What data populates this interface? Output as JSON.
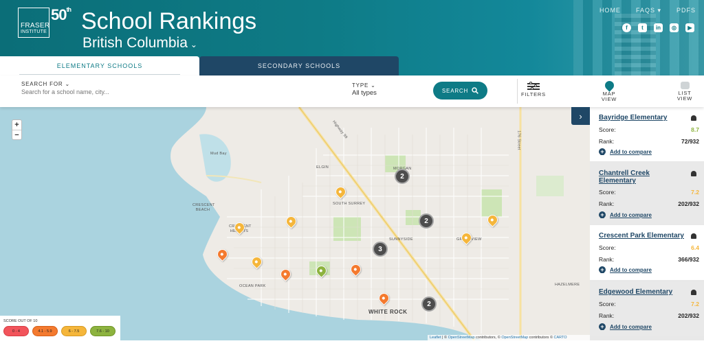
{
  "header": {
    "logo_line1": "FRASER",
    "logo_line2": "INSTITUTE",
    "anniversary": "50",
    "anniversary_sup": "th",
    "title": "School Rankings",
    "province": "British Columbia",
    "nav": [
      "HOME",
      "FAQS",
      "PDFS"
    ],
    "social": [
      "facebook",
      "twitter",
      "linkedin",
      "instagram",
      "youtube"
    ]
  },
  "tabs": {
    "elementary": "ELEMENTARY SCHOOLS",
    "secondary": "SECONDARY SCHOOLS"
  },
  "search": {
    "label": "SEARCH FOR",
    "placeholder": "Search for a school name, city...",
    "type_label": "TYPE",
    "type_value": "All types",
    "button": "SEARCH"
  },
  "tools": {
    "filters": "FILTERS",
    "map_view": "MAP VIEW",
    "list_view": "LIST VIEW"
  },
  "map": {
    "labels": [
      "Mud Bay",
      "ELGIN",
      "MORGAN",
      "SOUTH SURREY",
      "CRESCENT BEACH",
      "CRESCENT HEIGHTS",
      "SUNNYSIDE",
      "GRANDVIEW",
      "OCEAN PARK",
      "HAZELMERE",
      "WHITE ROCK",
      "Highway 99",
      "176 Street"
    ],
    "clusters": [
      "2",
      "2",
      "3",
      "2"
    ],
    "zoom_in": "+",
    "zoom_out": "−",
    "attribution_leaflet": "Leaflet",
    "attribution_sep1": " | © ",
    "attribution_osm1": "OpenStreetMap",
    "attribution_mid": " contributors, © ",
    "attribution_osm2": "OpenStreetMap",
    "attribution_mid2": " contributors © ",
    "attribution_carto": "CARTO"
  },
  "legend": {
    "title": "SCORE OUT OF 10",
    "ranges": [
      {
        "label": "0 - 4",
        "color": "#f2545b"
      },
      {
        "label": "4.1 - 5.9",
        "color": "#f47a2f"
      },
      {
        "label": "6 - 7.5",
        "color": "#f5b63b"
      },
      {
        "label": "7.6 - 10",
        "color": "#8db33f"
      }
    ]
  },
  "colors": {
    "teal": "#0e7b86",
    "navy": "#1f4766",
    "score_high": "#8db33f",
    "score_mid": "#f5b63b",
    "score_low": "#f47a2f"
  },
  "schools": [
    {
      "name": "Bayridge Elementary",
      "score_label": "Score:",
      "score": "8.7",
      "rank_label": "Rank:",
      "rank": "72/932",
      "compare": "Add to compare"
    },
    {
      "name": "Chantrell Creek Elementary",
      "score_label": "Score:",
      "score": "7.2",
      "rank_label": "Rank:",
      "rank": "202/932",
      "compare": "Add to compare"
    },
    {
      "name": "Crescent Park Elementary",
      "score_label": "Score:",
      "score": "6.4",
      "rank_label": "Rank:",
      "rank": "366/932",
      "compare": "Add to compare"
    },
    {
      "name": "Edgewood Elementary",
      "score_label": "Score:",
      "score": "7.2",
      "rank_label": "Rank:",
      "rank": "202/932",
      "compare": "Add to compare"
    }
  ]
}
